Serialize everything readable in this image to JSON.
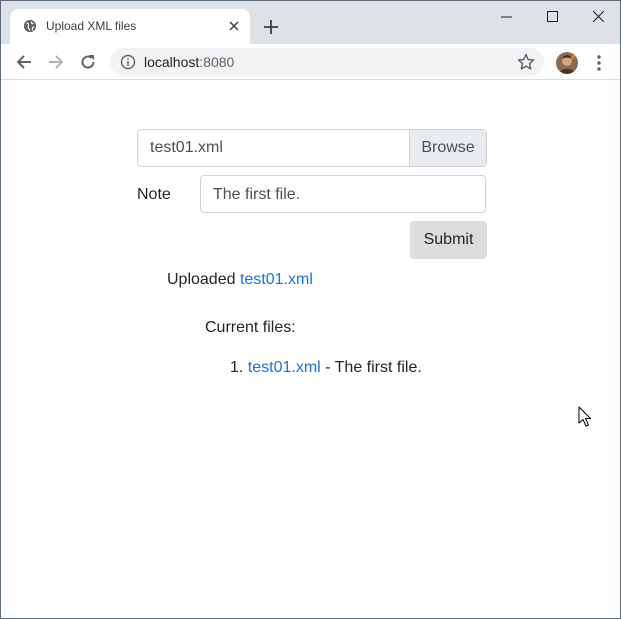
{
  "browser": {
    "tab": {
      "title": "Upload XML files"
    },
    "address": {
      "host": "localhost",
      "port": ":8080"
    }
  },
  "form": {
    "file": {
      "value": "test01.xml",
      "browse_label": "Browse"
    },
    "note": {
      "label": "Note",
      "value": "The first file."
    },
    "submit_label": "Submit"
  },
  "result": {
    "uploaded_prefix": "Uploaded ",
    "uploaded_file": "test01.xml"
  },
  "files": {
    "heading": "Current files:",
    "items": [
      {
        "number": "1.",
        "name": "test01.xml",
        "separator": " - ",
        "note": "The first file."
      }
    ]
  },
  "colors": {
    "link": "#1a73e8",
    "tabstrip": "#dee1e6",
    "button": "#dcdcdc"
  }
}
